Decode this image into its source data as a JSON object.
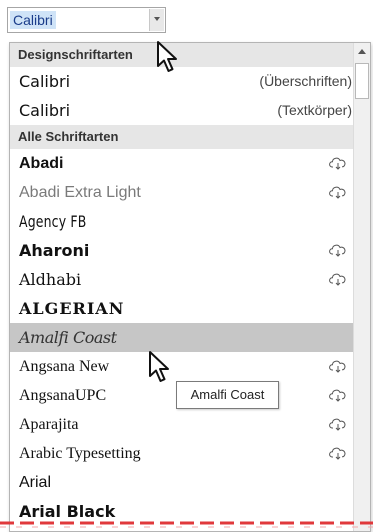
{
  "font_box": {
    "value": "Calibri"
  },
  "sections": {
    "design": "Designschriftarten",
    "all": "Alle Schriftarten"
  },
  "design_fonts": [
    {
      "name": "Calibri",
      "hint": "(Überschriften)"
    },
    {
      "name": "Calibri",
      "hint": "(Textkörper)"
    }
  ],
  "all_fonts": [
    {
      "name": "Abadi",
      "cloud": true
    },
    {
      "name": "Abadi Extra Light",
      "cloud": true
    },
    {
      "name": "Agency FB",
      "cloud": false
    },
    {
      "name": "Aharoni",
      "cloud": true
    },
    {
      "name": "Aldhabi",
      "cloud": true
    },
    {
      "name": "ALGERIAN",
      "cloud": false
    },
    {
      "name": "Amalfi Coast",
      "cloud": false,
      "hovered": true
    },
    {
      "name": "Angsana New",
      "cloud": true
    },
    {
      "name": "AngsanaUPC",
      "cloud": true
    },
    {
      "name": "Aparajita",
      "cloud": true
    },
    {
      "name": "Arabic Typesetting",
      "cloud": true
    },
    {
      "name": "Arial",
      "cloud": false
    },
    {
      "name": "Arial Black",
      "cloud": false
    }
  ],
  "tooltip": "Amalfi Coast",
  "colors": {
    "selection": "#cfe3f7",
    "hover_row": "#c6c6c6",
    "section_header": "#e6e6e6",
    "torn_edge": "#e0383b"
  },
  "icons": {
    "cloud": "cloud-download-icon",
    "cursor": "mouse-pointer-icon"
  }
}
